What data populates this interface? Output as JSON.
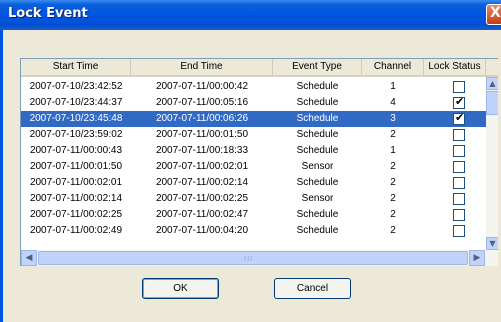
{
  "window": {
    "title": "Lock Event",
    "close_symbol": "X"
  },
  "table": {
    "headers": [
      "Start Time",
      "End Time",
      "Event Type",
      "Channel",
      "Lock Status"
    ],
    "rows": [
      {
        "start": "2007-07-10/23:42:52",
        "end": "2007-07-11/00:00:42",
        "type": "Schedule",
        "channel": "1",
        "locked": false,
        "lock_mark": ""
      },
      {
        "start": "2007-07-10/23:44:37",
        "end": "2007-07-11/00:05:16",
        "type": "Schedule",
        "channel": "4",
        "locked": true,
        "lock_mark": "✔"
      },
      {
        "start": "2007-07-10/23:45:48",
        "end": "2007-07-11/00:06:26",
        "type": "Schedule",
        "channel": "3",
        "locked": true,
        "lock_mark": "✔"
      },
      {
        "start": "2007-07-10/23:59:02",
        "end": "2007-07-11/00:01:50",
        "type": "Schedule",
        "channel": "2",
        "locked": false,
        "lock_mark": ""
      },
      {
        "start": "2007-07-11/00:00:43",
        "end": "2007-07-11/00:18:33",
        "type": "Schedule",
        "channel": "1",
        "locked": false,
        "lock_mark": ""
      },
      {
        "start": "2007-07-11/00:01:50",
        "end": "2007-07-11/00:02:01",
        "type": "Sensor",
        "channel": "2",
        "locked": false,
        "lock_mark": ""
      },
      {
        "start": "2007-07-11/00:02:01",
        "end": "2007-07-11/00:02:14",
        "type": "Schedule",
        "channel": "2",
        "locked": false,
        "lock_mark": ""
      },
      {
        "start": "2007-07-11/00:02:14",
        "end": "2007-07-11/00:02:25",
        "type": "Sensor",
        "channel": "2",
        "locked": false,
        "lock_mark": ""
      },
      {
        "start": "2007-07-11/00:02:25",
        "end": "2007-07-11/00:02:47",
        "type": "Schedule",
        "channel": "2",
        "locked": false,
        "lock_mark": ""
      },
      {
        "start": "2007-07-11/00:02:49",
        "end": "2007-07-11/00:04:20",
        "type": "Schedule",
        "channel": "2",
        "locked": false,
        "lock_mark": ""
      }
    ],
    "selected_row": 2
  },
  "scroll": {
    "up_symbol": "▲",
    "down_symbol": "▼",
    "left_symbol": "◀",
    "right_symbol": "▶",
    "grip": "III"
  },
  "buttons": {
    "ok": "OK",
    "cancel": "Cancel"
  },
  "colors": {
    "selection": "#316ac5",
    "title_bar": "#0054e3",
    "dialog_bg": "#ece9d8"
  }
}
